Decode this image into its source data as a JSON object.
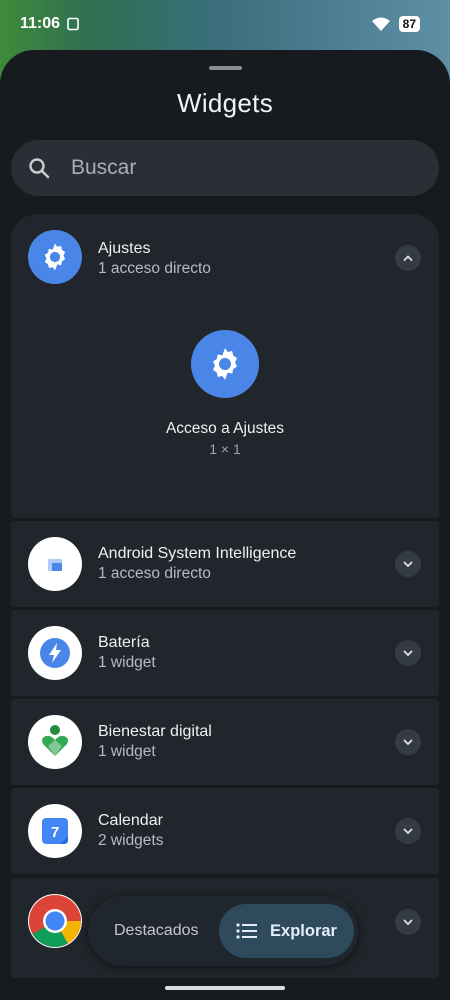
{
  "status_bar": {
    "time": "11:06",
    "battery": "87"
  },
  "sheet": {
    "title": "Widgets"
  },
  "search": {
    "placeholder": "Buscar"
  },
  "apps": [
    {
      "name": "Ajustes",
      "detail": "1 acceso directo",
      "expanded": true,
      "preview": {
        "label": "Acceso a Ajustes",
        "size": "1 × 1"
      }
    },
    {
      "name": "Android System Intelligence",
      "detail": "1 acceso directo"
    },
    {
      "name": "Batería",
      "detail": "1 widget"
    },
    {
      "name": "Bienestar digital",
      "detail": "1 widget"
    },
    {
      "name": "Calendar",
      "detail": "2 widgets",
      "icon_text": "7"
    },
    {
      "name": "Chrome",
      "detail": ""
    }
  ],
  "bottom_nav": {
    "featured": "Destacados",
    "explore": "Explorar"
  },
  "colors": {
    "sheet_bg": "#171b20",
    "card_bg": "#21262c",
    "accent_blue": "#4a86e8",
    "explore_bg": "#2e4a5c"
  }
}
